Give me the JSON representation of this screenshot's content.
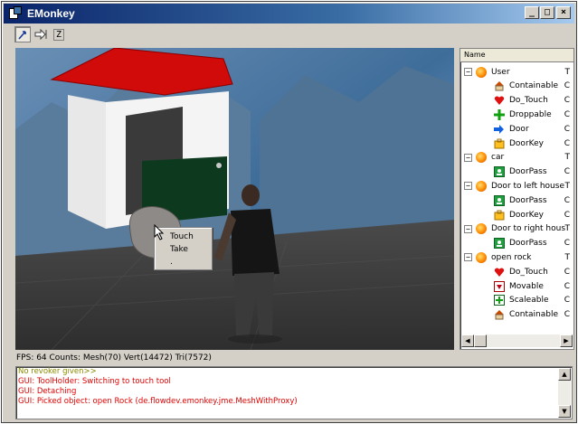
{
  "window": {
    "title": "EMonkey",
    "controls": {
      "minimize": "_",
      "maximize": "□",
      "close": "×"
    }
  },
  "toolbar": {
    "tools": [
      {
        "name": "touch-tool",
        "icon": "pointer-icon",
        "active": true
      },
      {
        "name": "move-tool",
        "icon": "arrow-right-icon",
        "active": false
      },
      {
        "name": "z-tool",
        "label": "Z",
        "active": false
      }
    ]
  },
  "context_menu": {
    "items": [
      "Touch",
      "Take",
      "."
    ]
  },
  "tree": {
    "header": "Name",
    "rows": [
      {
        "label": "User",
        "icon": "orb-icon",
        "expander": "−",
        "level": 0,
        "trail": "T"
      },
      {
        "label": "Containable",
        "icon": "house-icon",
        "level": 1,
        "trail": "C"
      },
      {
        "label": "Do_Touch",
        "icon": "heart-icon",
        "level": 1,
        "trail": "C"
      },
      {
        "label": "Droppable",
        "icon": "plus-icon",
        "level": 1,
        "trail": "C"
      },
      {
        "label": "Door",
        "icon": "blue-arrow-icon",
        "level": 1,
        "trail": "C"
      },
      {
        "label": "DoorKey",
        "icon": "key-icon",
        "level": 1,
        "trail": "C"
      },
      {
        "label": "car",
        "icon": "orb-icon",
        "expander": "−",
        "level": 0,
        "trail": "T"
      },
      {
        "label": "DoorPass",
        "icon": "pass-icon",
        "level": 1,
        "trail": "C"
      },
      {
        "label": "Door to left house",
        "icon": "orb-icon",
        "expander": "−",
        "level": 0,
        "trail": "T"
      },
      {
        "label": "DoorPass",
        "icon": "pass-icon",
        "level": 1,
        "trail": "C"
      },
      {
        "label": "DoorKey",
        "icon": "key-icon",
        "level": 1,
        "trail": "C"
      },
      {
        "label": "Door to right hous",
        "icon": "orb-icon",
        "expander": "−",
        "level": 0,
        "trail": "T"
      },
      {
        "label": "DoorPass",
        "icon": "pass-icon",
        "level": 1,
        "trail": "C"
      },
      {
        "label": "open rock",
        "icon": "orb-icon",
        "expander": "−",
        "level": 0,
        "trail": "T"
      },
      {
        "label": "Do_Touch",
        "icon": "heart-icon",
        "level": 1,
        "trail": "C"
      },
      {
        "label": "Movable",
        "icon": "movable-icon",
        "level": 1,
        "trail": "C"
      },
      {
        "label": "Scaleable",
        "icon": "scale-icon",
        "level": 1,
        "trail": "C"
      },
      {
        "label": "Containable",
        "icon": "house-icon",
        "level": 1,
        "trail": "C"
      }
    ]
  },
  "status": {
    "fps_text": "FPS: 64 Counts: Mesh(70) Vert(14472) Tri(7572)"
  },
  "log": {
    "lines": [
      {
        "text": "No revoker given>>",
        "color": "#8a8a00"
      },
      {
        "text": "GUI:  ToolHolder: Switching to touch tool",
        "color": "#e00000"
      },
      {
        "text": "GUI:  Detaching",
        "color": "#e00000"
      },
      {
        "text": "GUI:  Picked object: open Rock (de.flowdev.emonkey.jme.MeshWithProxy)",
        "color": "#e00000"
      }
    ]
  },
  "colors": {
    "titlebar_start": "#0a246a",
    "roof": "#d10a0a",
    "door": "#0d3a1e",
    "log_error": "#e00000",
    "log_warning": "#8a8a00"
  }
}
